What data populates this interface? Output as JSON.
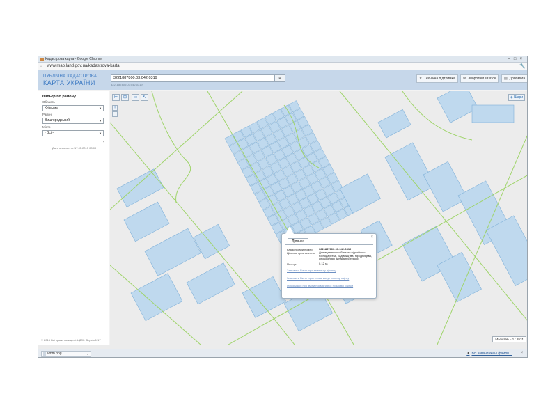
{
  "browser": {
    "title": "Кадастрова карта - Google Chrome",
    "url": "www.map.land.gov.ua/kadastrova-karta"
  },
  "header": {
    "logo_line1": "ПУБЛІЧНА КАДАСТРОВА",
    "logo_line2": "КАРТА УКРАЇНИ",
    "search_value": "3221887800:03:042:0319",
    "search_hint": "3221887800:03:042:0319",
    "tech_support": "Технічна підтримка",
    "feedback": "Зворотній зв'язок",
    "help": "Допомога"
  },
  "sidebar": {
    "filter_title": "Фільтр по району",
    "oblast_label": "Область",
    "oblast_value": "Київська",
    "raion_label": "Район",
    "raion_value": "Вишгородський",
    "misto_label": "Місто",
    "misto_value": "- Всі -",
    "update_date": "Дата оновлення: 17.05.2015 03:00",
    "copyright": "© 2015 Всі права захищені. ЦДЗК. Версія 1.17"
  },
  "map": {
    "layers_label": "Шари",
    "scale_text": "Масштаб = 1 : 8531",
    "zoom_in": "+",
    "zoom_out": "−"
  },
  "popup": {
    "tab": "Ділянка",
    "cadastral_label": "Кадастровий номер:",
    "cadastral_value": "3221887800:03:042:0319",
    "purpose_label": "Цільове призначення:",
    "purpose_value": "Для ведення особистого підсобного господарства, садівництва, городництва, сінокосіння і випасання худоби",
    "area_label": "Площа:",
    "area_value": "0.12 га",
    "link1": "Замовити Витяг про земельну ділянку",
    "link2": "Замовити Витяг про нормативну грошову оцінку",
    "link3": "Інформація про зміни нормативної грошової оцінки"
  },
  "downloads": {
    "file_name": "vmm.png",
    "all_downloads": "Всі завантажені файли..."
  },
  "colors": {
    "parcel_fill": "#bfd9ee",
    "parcel_stroke": "#7fb0d8",
    "road_line": "#9fd46a",
    "accent": "#3a78c2"
  }
}
